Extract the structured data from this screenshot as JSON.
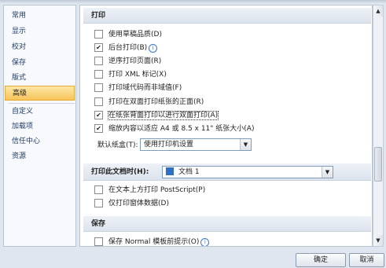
{
  "sidebar": {
    "items": [
      {
        "label": "常用"
      },
      {
        "label": "显示"
      },
      {
        "label": "校对"
      },
      {
        "label": "保存"
      },
      {
        "label": "版式"
      },
      {
        "label": "高级"
      },
      {
        "label": "自定义"
      },
      {
        "label": "加载项"
      },
      {
        "label": "信任中心"
      },
      {
        "label": "资源"
      }
    ],
    "active_index": 5
  },
  "print_section": {
    "title": "打印",
    "options": [
      {
        "label": "使用草稿品质(D)",
        "checked": false
      },
      {
        "label": "后台打印(B)",
        "checked": true,
        "info": true
      },
      {
        "label": "逆序打印页面(R)",
        "checked": false
      },
      {
        "label": "打印 XML 标记(X)",
        "checked": false
      },
      {
        "label": "打印域代码而非域值(F)",
        "checked": false
      },
      {
        "label": "打印在双面打印纸张的正面(R)",
        "checked": false
      },
      {
        "label": "在纸张背面打印以进行双面打印(A)",
        "checked": true
      },
      {
        "label": "缩放内容以适应 A4 或 8.5 x 11\" 纸张大小(A)",
        "checked": true
      }
    ],
    "default_tray_label": "默认纸盒(T):",
    "default_tray_value": "使用打印机设置"
  },
  "print_doc_section": {
    "title": "打印此文档时(H):",
    "doc_value": "文档 1",
    "options": [
      {
        "label": "在文本上方打印 PostScript(P)",
        "checked": false
      },
      {
        "label": "仅打印窗体数据(D)",
        "checked": false
      }
    ]
  },
  "save_section": {
    "title": "保存",
    "options": [
      {
        "label": "保存 Normal 模板前提示(O)",
        "checked": false,
        "info": true
      }
    ]
  },
  "buttons": {
    "ok": "确定",
    "cancel": "取消"
  },
  "icons": {
    "info": "info-icon",
    "dropdown": "chevron-down-icon",
    "document": "document-icon",
    "scroll_up": "scroll-up-icon",
    "scroll_down": "scroll-down-icon"
  }
}
